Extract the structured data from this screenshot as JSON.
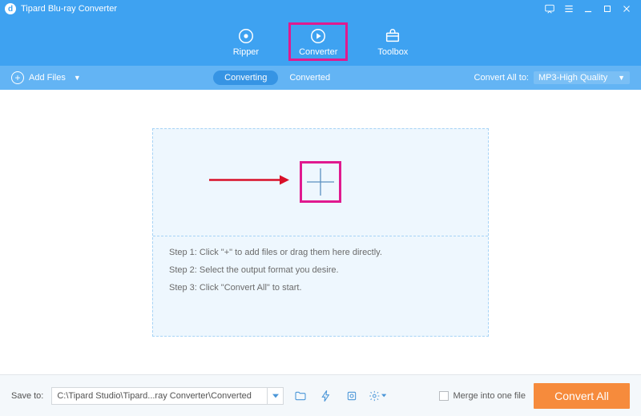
{
  "app": {
    "title": "Tipard Blu-ray Converter"
  },
  "tabs": {
    "ripper": "Ripper",
    "converter": "Converter",
    "toolbox": "Toolbox"
  },
  "subbar": {
    "add_files": "Add Files",
    "converting": "Converting",
    "converted": "Converted",
    "convert_all_label": "Convert All to:",
    "format_selected": "MP3-High Quality"
  },
  "dropzone": {
    "step1": "Step 1: Click \"+\" to add files or drag them here directly.",
    "step2": "Step 2: Select the output format you desire.",
    "step3": "Step 3: Click \"Convert All\" to start."
  },
  "footer": {
    "save_label": "Save to:",
    "save_path": "C:\\Tipard Studio\\Tipard...ray Converter\\Converted",
    "merge_label": "Merge into one file",
    "convert_btn": "Convert All"
  }
}
